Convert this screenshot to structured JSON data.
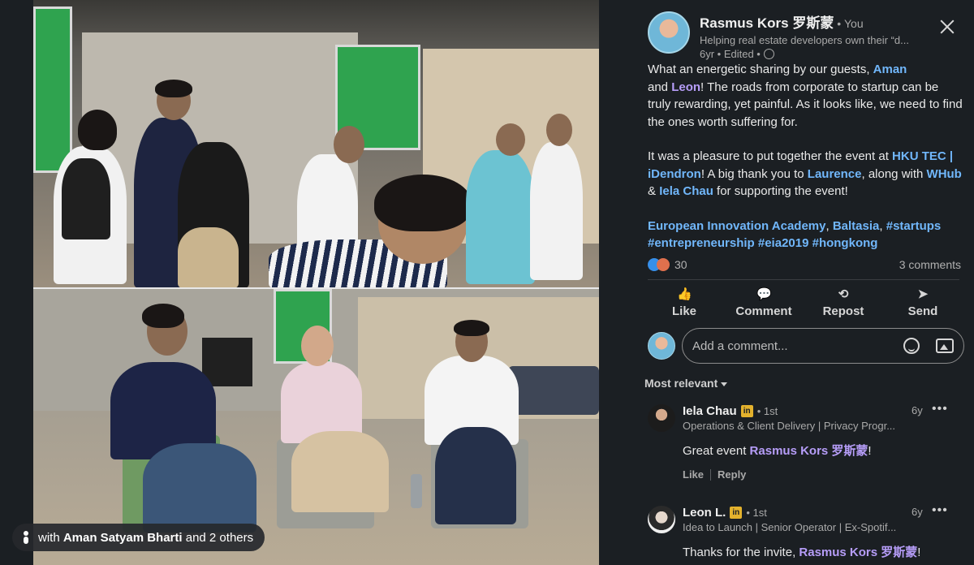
{
  "photo": {
    "tag_prefix": "with ",
    "tag_name": "Aman Satyam Bharti",
    "tag_suffix": " and 2 others"
  },
  "post": {
    "author_name": "Rasmus Kors 罗斯蒙",
    "author_you": " • You",
    "author_headline": "Helping real estate developers own their “d...",
    "author_meta": "6yr • Edited •",
    "p1_a": "What an energetic sharing by our guests, ",
    "p1_l1": "Aman",
    "p1_b": " and ",
    "p1_l2": "Leon",
    "p1_c": "! The roads from corporate to startup can be truly rewarding, yet painful. As it looks like, we need to find the ones worth suffering for.",
    "p2_a": "It was a pleasure to put together the event at ",
    "p2_l1": "HKU TEC | iDendron",
    "p2_b": "! A big thank you to ",
    "p2_l2": "Laurence",
    "p2_c": ", along with ",
    "p2_l3": "WHub",
    "p2_d": " & ",
    "p2_l4": "Iela Chau",
    "p2_e": " for supporting the event!",
    "p3_l1": "European Innovation Academy",
    "p3_a": ", ",
    "p3_l2": "Baltasia",
    "p3_b": ", ",
    "p3_tags": "#startups #entrepreneurship #eia2019 #hongkong",
    "reaction_count": "30",
    "comments_count": "3 comments"
  },
  "actions": [
    {
      "label": "Like",
      "icon": "👍"
    },
    {
      "label": "Comment",
      "icon": "💬"
    },
    {
      "label": "Repost",
      "icon": "⟲"
    },
    {
      "label": "Send",
      "icon": "➤"
    }
  ],
  "comment_input": {
    "placeholder": "Add a comment..."
  },
  "sort_label": "Most relevant",
  "comments": [
    {
      "name": "Iela Chau",
      "degree": "• 1st",
      "headline": "Operations & Client Delivery | Privacy Progr...",
      "time": "6y",
      "text_a": "Great event ",
      "mention": "Rasmus Kors 罗斯蒙",
      "text_b": "!",
      "like": "Like",
      "reply": "Reply"
    },
    {
      "name": "Leon L.",
      "degree": "• 1st",
      "headline": "Idea to Launch | Senior Operator | Ex-Spotif...",
      "time": "6y",
      "text_a": "Thanks for the invite, ",
      "mention": "Rasmus Kors 罗斯蒙",
      "text_b": "!"
    }
  ],
  "colors": {
    "background": "#1b1f23",
    "link_blue": "#71b7fb",
    "link_purple": "#b69df8",
    "premium_badge": "#e4b22d"
  }
}
